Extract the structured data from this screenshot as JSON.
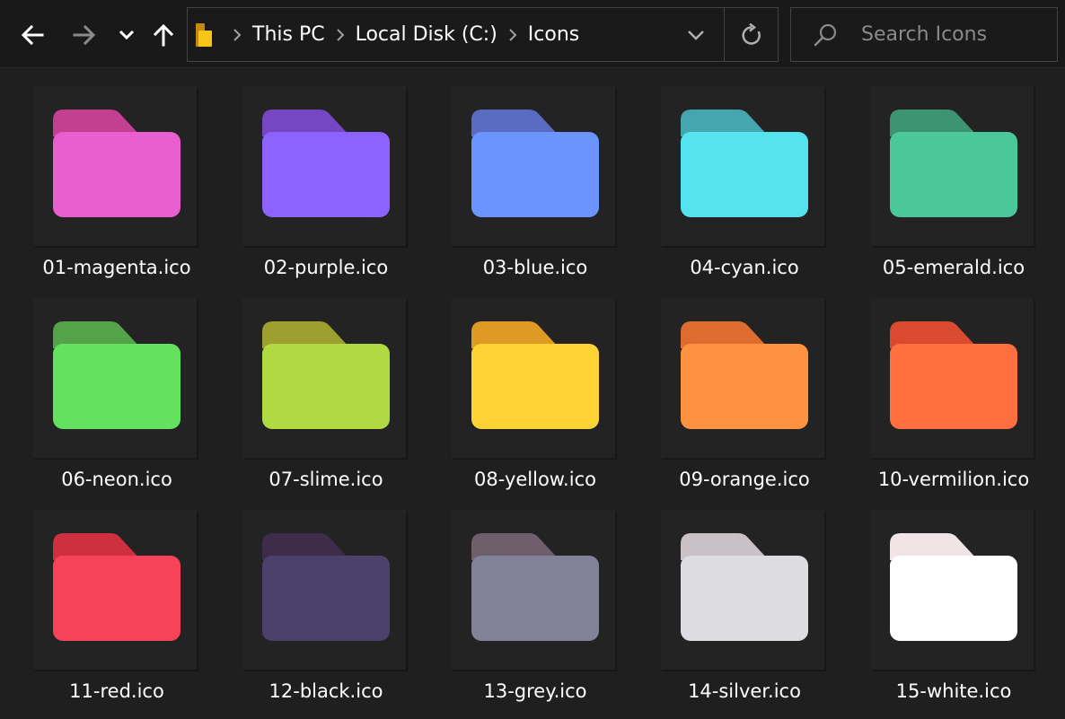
{
  "navigation": {
    "back": "back-arrow",
    "forward": "forward-arrow",
    "recent": "chevron-down",
    "up": "up-arrow"
  },
  "address": {
    "crumbs": [
      "This PC",
      "Local Disk (C:)",
      "Icons"
    ],
    "folder_icon": "folder-icon",
    "folder_icon_color": "#f5c518"
  },
  "search": {
    "placeholder": "Search Icons",
    "value": ""
  },
  "files": [
    {
      "name": "01-magenta.ico",
      "tab": "#c2408f",
      "body": "#ea5fcf"
    },
    {
      "name": "02-purple.ico",
      "tab": "#7647c2",
      "body": "#8c63ff"
    },
    {
      "name": "03-blue.ico",
      "tab": "#5a6cc2",
      "body": "#6b94ff"
    },
    {
      "name": "04-cyan.ico",
      "tab": "#45a6b0",
      "body": "#55e4ef"
    },
    {
      "name": "05-emerald.ico",
      "tab": "#3c9472",
      "body": "#4bc89b"
    },
    {
      "name": "06-neon.ico",
      "tab": "#55a348",
      "body": "#65e160"
    },
    {
      "name": "07-slime.ico",
      "tab": "#9da02e",
      "body": "#b1da42"
    },
    {
      "name": "08-yellow.ico",
      "tab": "#de9a25",
      "body": "#ffd335"
    },
    {
      "name": "09-orange.ico",
      "tab": "#de6c2e",
      "body": "#ff9240"
    },
    {
      "name": "10-vermilion.ico",
      "tab": "#d94a2f",
      "body": "#ff6f40"
    },
    {
      "name": "11-red.ico",
      "tab": "#cf3040",
      "body": "#f6435a"
    },
    {
      "name": "12-black.ico",
      "tab": "#3e2c4b",
      "body": "#4c416b"
    },
    {
      "name": "13-grey.ico",
      "tab": "#6f5e6c",
      "body": "#828398"
    },
    {
      "name": "14-silver.ico",
      "tab": "#c9c1c6",
      "body": "#dcdce1"
    },
    {
      "name": "15-white.ico",
      "tab": "#f0e4e6",
      "body": "#ffffff"
    }
  ]
}
